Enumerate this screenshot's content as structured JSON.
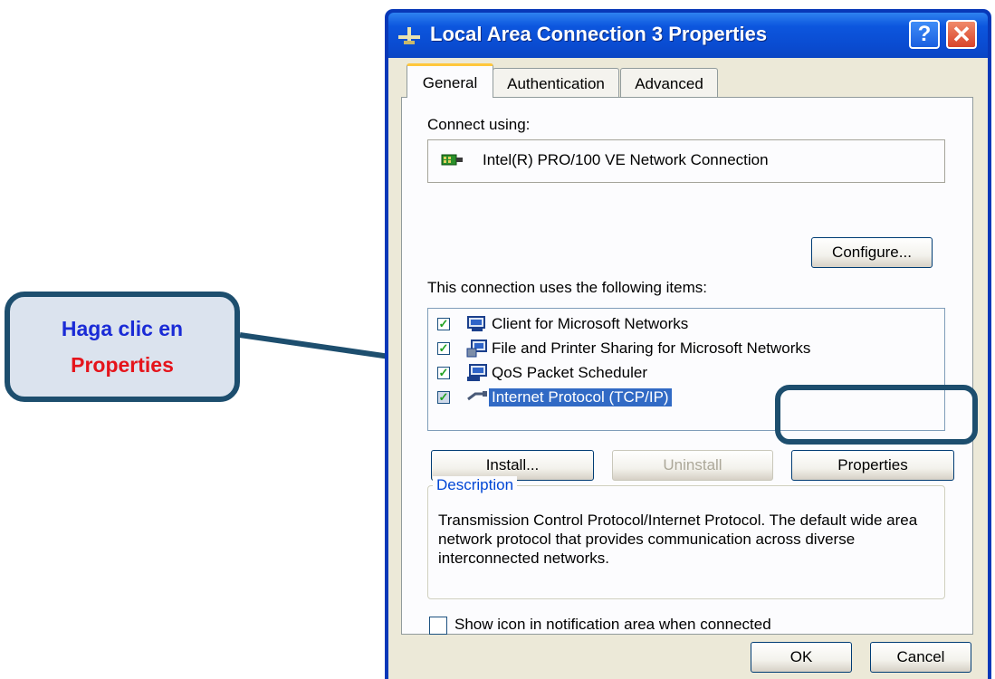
{
  "window": {
    "title": "Local Area Connection 3 Properties",
    "help_button": "?",
    "close_button": "✕"
  },
  "tabs": [
    {
      "label": "General",
      "active": true
    },
    {
      "label": "Authentication",
      "active": false
    },
    {
      "label": "Advanced",
      "active": false
    }
  ],
  "general": {
    "connect_using_label": "Connect using:",
    "adapter_name": "Intel(R) PRO/100 VE Network Connection",
    "configure_button": "Configure...",
    "items_label": "This connection uses the following items:",
    "items": [
      {
        "label": "Client for Microsoft Networks",
        "checked": true,
        "selected": false,
        "icon": "network-client-icon"
      },
      {
        "label": "File and Printer Sharing for Microsoft Networks",
        "checked": true,
        "selected": false,
        "icon": "file-sharing-icon"
      },
      {
        "label": "QoS Packet Scheduler",
        "checked": true,
        "selected": false,
        "icon": "qos-scheduler-icon"
      },
      {
        "label": "Internet Protocol (TCP/IP)",
        "checked": true,
        "selected": true,
        "icon": "protocol-icon"
      }
    ],
    "install_button": "Install...",
    "uninstall_button": "Uninstall",
    "properties_button": "Properties",
    "description_legend": "Description",
    "description_text": "Transmission Control Protocol/Internet Protocol. The default wide area network protocol that provides communication across diverse interconnected networks.",
    "show_icon_label": "Show icon in notification area when connected",
    "show_icon_checked": false
  },
  "footer": {
    "ok_button": "OK",
    "cancel_button": "Cancel"
  },
  "callout": {
    "line1": "Haga clic en",
    "line2": "Properties",
    "line1_color": "#1a2bd6",
    "line2_color": "#e5141b",
    "frame_color": "#1d4e6e"
  },
  "colors": {
    "titlebar": "#0a4fd8",
    "selection": "#316ac5",
    "dialog_face": "#ece9d8"
  }
}
